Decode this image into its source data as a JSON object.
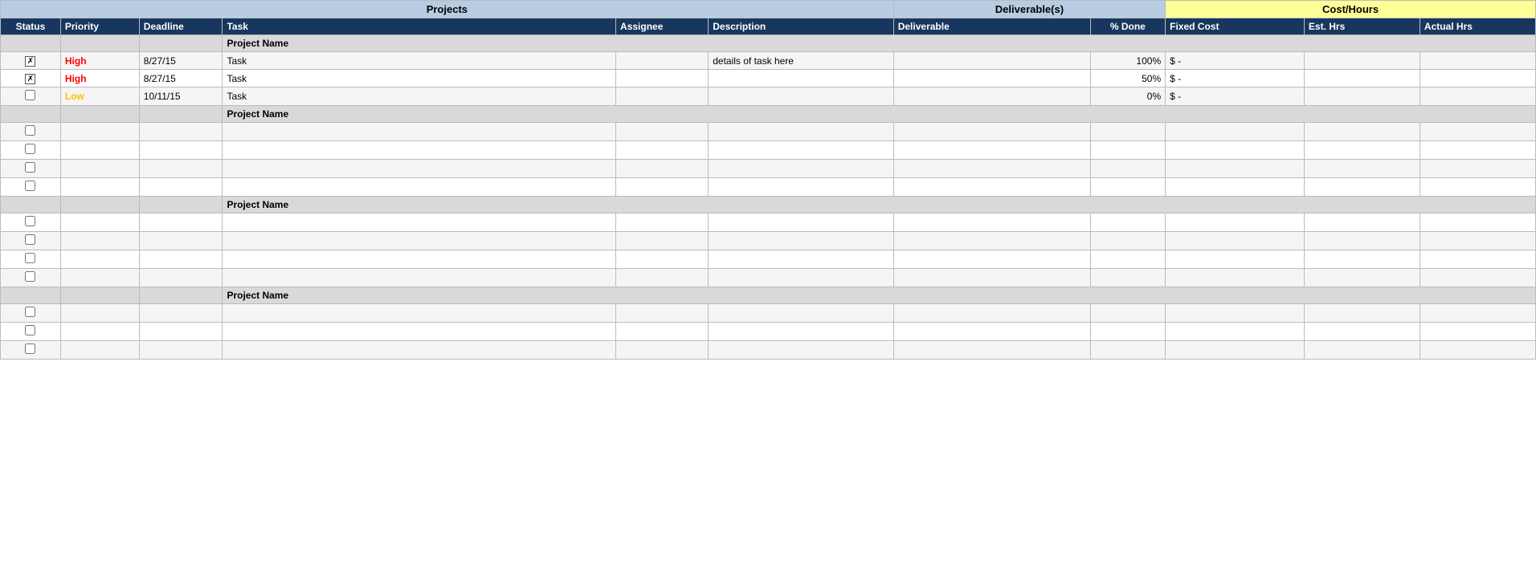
{
  "header": {
    "group1_label": "Projects",
    "group2_label": "Deliverable(s)",
    "group3_label": "Cost/Hours",
    "col_status": "Status",
    "col_priority": "Priority",
    "col_deadline": "Deadline",
    "col_task": "Task",
    "col_assignee": "Assignee",
    "col_desc": "Description",
    "col_deliverable": "Deliverable",
    "col_pctdone": "% Done",
    "col_fixedcost": "Fixed Cost",
    "col_esthrs": "Est. Hrs",
    "col_actualhrs": "Actual Hrs"
  },
  "projects": [
    {
      "name": "Project Name",
      "rows": [
        {
          "status": "checked",
          "priority": "High",
          "priority_class": "priority-high",
          "deadline": "8/27/15",
          "task": "Task",
          "assignee": "",
          "description": "details of task here",
          "deliverable": "",
          "pct_done": "100%",
          "fixed_cost": "$          -",
          "est_hrs": "",
          "actual_hrs": ""
        },
        {
          "status": "checked",
          "priority": "High",
          "priority_class": "priority-high",
          "deadline": "8/27/15",
          "task": "Task",
          "assignee": "",
          "description": "",
          "deliverable": "",
          "pct_done": "50%",
          "fixed_cost": "$          -",
          "est_hrs": "",
          "actual_hrs": ""
        },
        {
          "status": "unchecked",
          "priority": "Low",
          "priority_class": "priority-low",
          "deadline": "10/11/15",
          "task": "Task",
          "assignee": "",
          "description": "",
          "deliverable": "",
          "pct_done": "0%",
          "fixed_cost": "$          -",
          "est_hrs": "",
          "actual_hrs": ""
        }
      ]
    },
    {
      "name": "Project Name",
      "rows": [
        {
          "status": "unchecked",
          "priority": "",
          "priority_class": "",
          "deadline": "",
          "task": "",
          "assignee": "",
          "description": "",
          "deliverable": "",
          "pct_done": "",
          "fixed_cost": "",
          "est_hrs": "",
          "actual_hrs": ""
        },
        {
          "status": "unchecked",
          "priority": "",
          "priority_class": "",
          "deadline": "",
          "task": "",
          "assignee": "",
          "description": "",
          "deliverable": "",
          "pct_done": "",
          "fixed_cost": "",
          "est_hrs": "",
          "actual_hrs": ""
        },
        {
          "status": "unchecked",
          "priority": "",
          "priority_class": "",
          "deadline": "",
          "task": "",
          "assignee": "",
          "description": "",
          "deliverable": "",
          "pct_done": "",
          "fixed_cost": "",
          "est_hrs": "",
          "actual_hrs": ""
        },
        {
          "status": "unchecked",
          "priority": "",
          "priority_class": "",
          "deadline": "",
          "task": "",
          "assignee": "",
          "description": "",
          "deliverable": "",
          "pct_done": "",
          "fixed_cost": "",
          "est_hrs": "",
          "actual_hrs": ""
        }
      ]
    },
    {
      "name": "Project Name",
      "rows": [
        {
          "status": "unchecked",
          "priority": "",
          "priority_class": "",
          "deadline": "",
          "task": "",
          "assignee": "",
          "description": "",
          "deliverable": "",
          "pct_done": "",
          "fixed_cost": "",
          "est_hrs": "",
          "actual_hrs": ""
        },
        {
          "status": "unchecked",
          "priority": "",
          "priority_class": "",
          "deadline": "",
          "task": "",
          "assignee": "",
          "description": "",
          "deliverable": "",
          "pct_done": "",
          "fixed_cost": "",
          "est_hrs": "",
          "actual_hrs": ""
        },
        {
          "status": "unchecked",
          "priority": "",
          "priority_class": "",
          "deadline": "",
          "task": "",
          "assignee": "",
          "description": "",
          "deliverable": "",
          "pct_done": "",
          "fixed_cost": "",
          "est_hrs": "",
          "actual_hrs": ""
        },
        {
          "status": "unchecked",
          "priority": "",
          "priority_class": "",
          "deadline": "",
          "task": "",
          "assignee": "",
          "description": "",
          "deliverable": "",
          "pct_done": "",
          "fixed_cost": "",
          "est_hrs": "",
          "actual_hrs": ""
        }
      ]
    },
    {
      "name": "Project Name",
      "rows": [
        {
          "status": "unchecked",
          "priority": "",
          "priority_class": "",
          "deadline": "",
          "task": "",
          "assignee": "",
          "description": "",
          "deliverable": "",
          "pct_done": "",
          "fixed_cost": "",
          "est_hrs": "",
          "actual_hrs": ""
        },
        {
          "status": "unchecked",
          "priority": "",
          "priority_class": "",
          "deadline": "",
          "task": "",
          "assignee": "",
          "description": "",
          "deliverable": "",
          "pct_done": "",
          "fixed_cost": "",
          "est_hrs": "",
          "actual_hrs": ""
        },
        {
          "status": "unchecked",
          "priority": "",
          "priority_class": "",
          "deadline": "",
          "task": "",
          "assignee": "",
          "description": "",
          "deliverable": "",
          "pct_done": "",
          "fixed_cost": "",
          "est_hrs": "",
          "actual_hrs": ""
        }
      ]
    }
  ]
}
